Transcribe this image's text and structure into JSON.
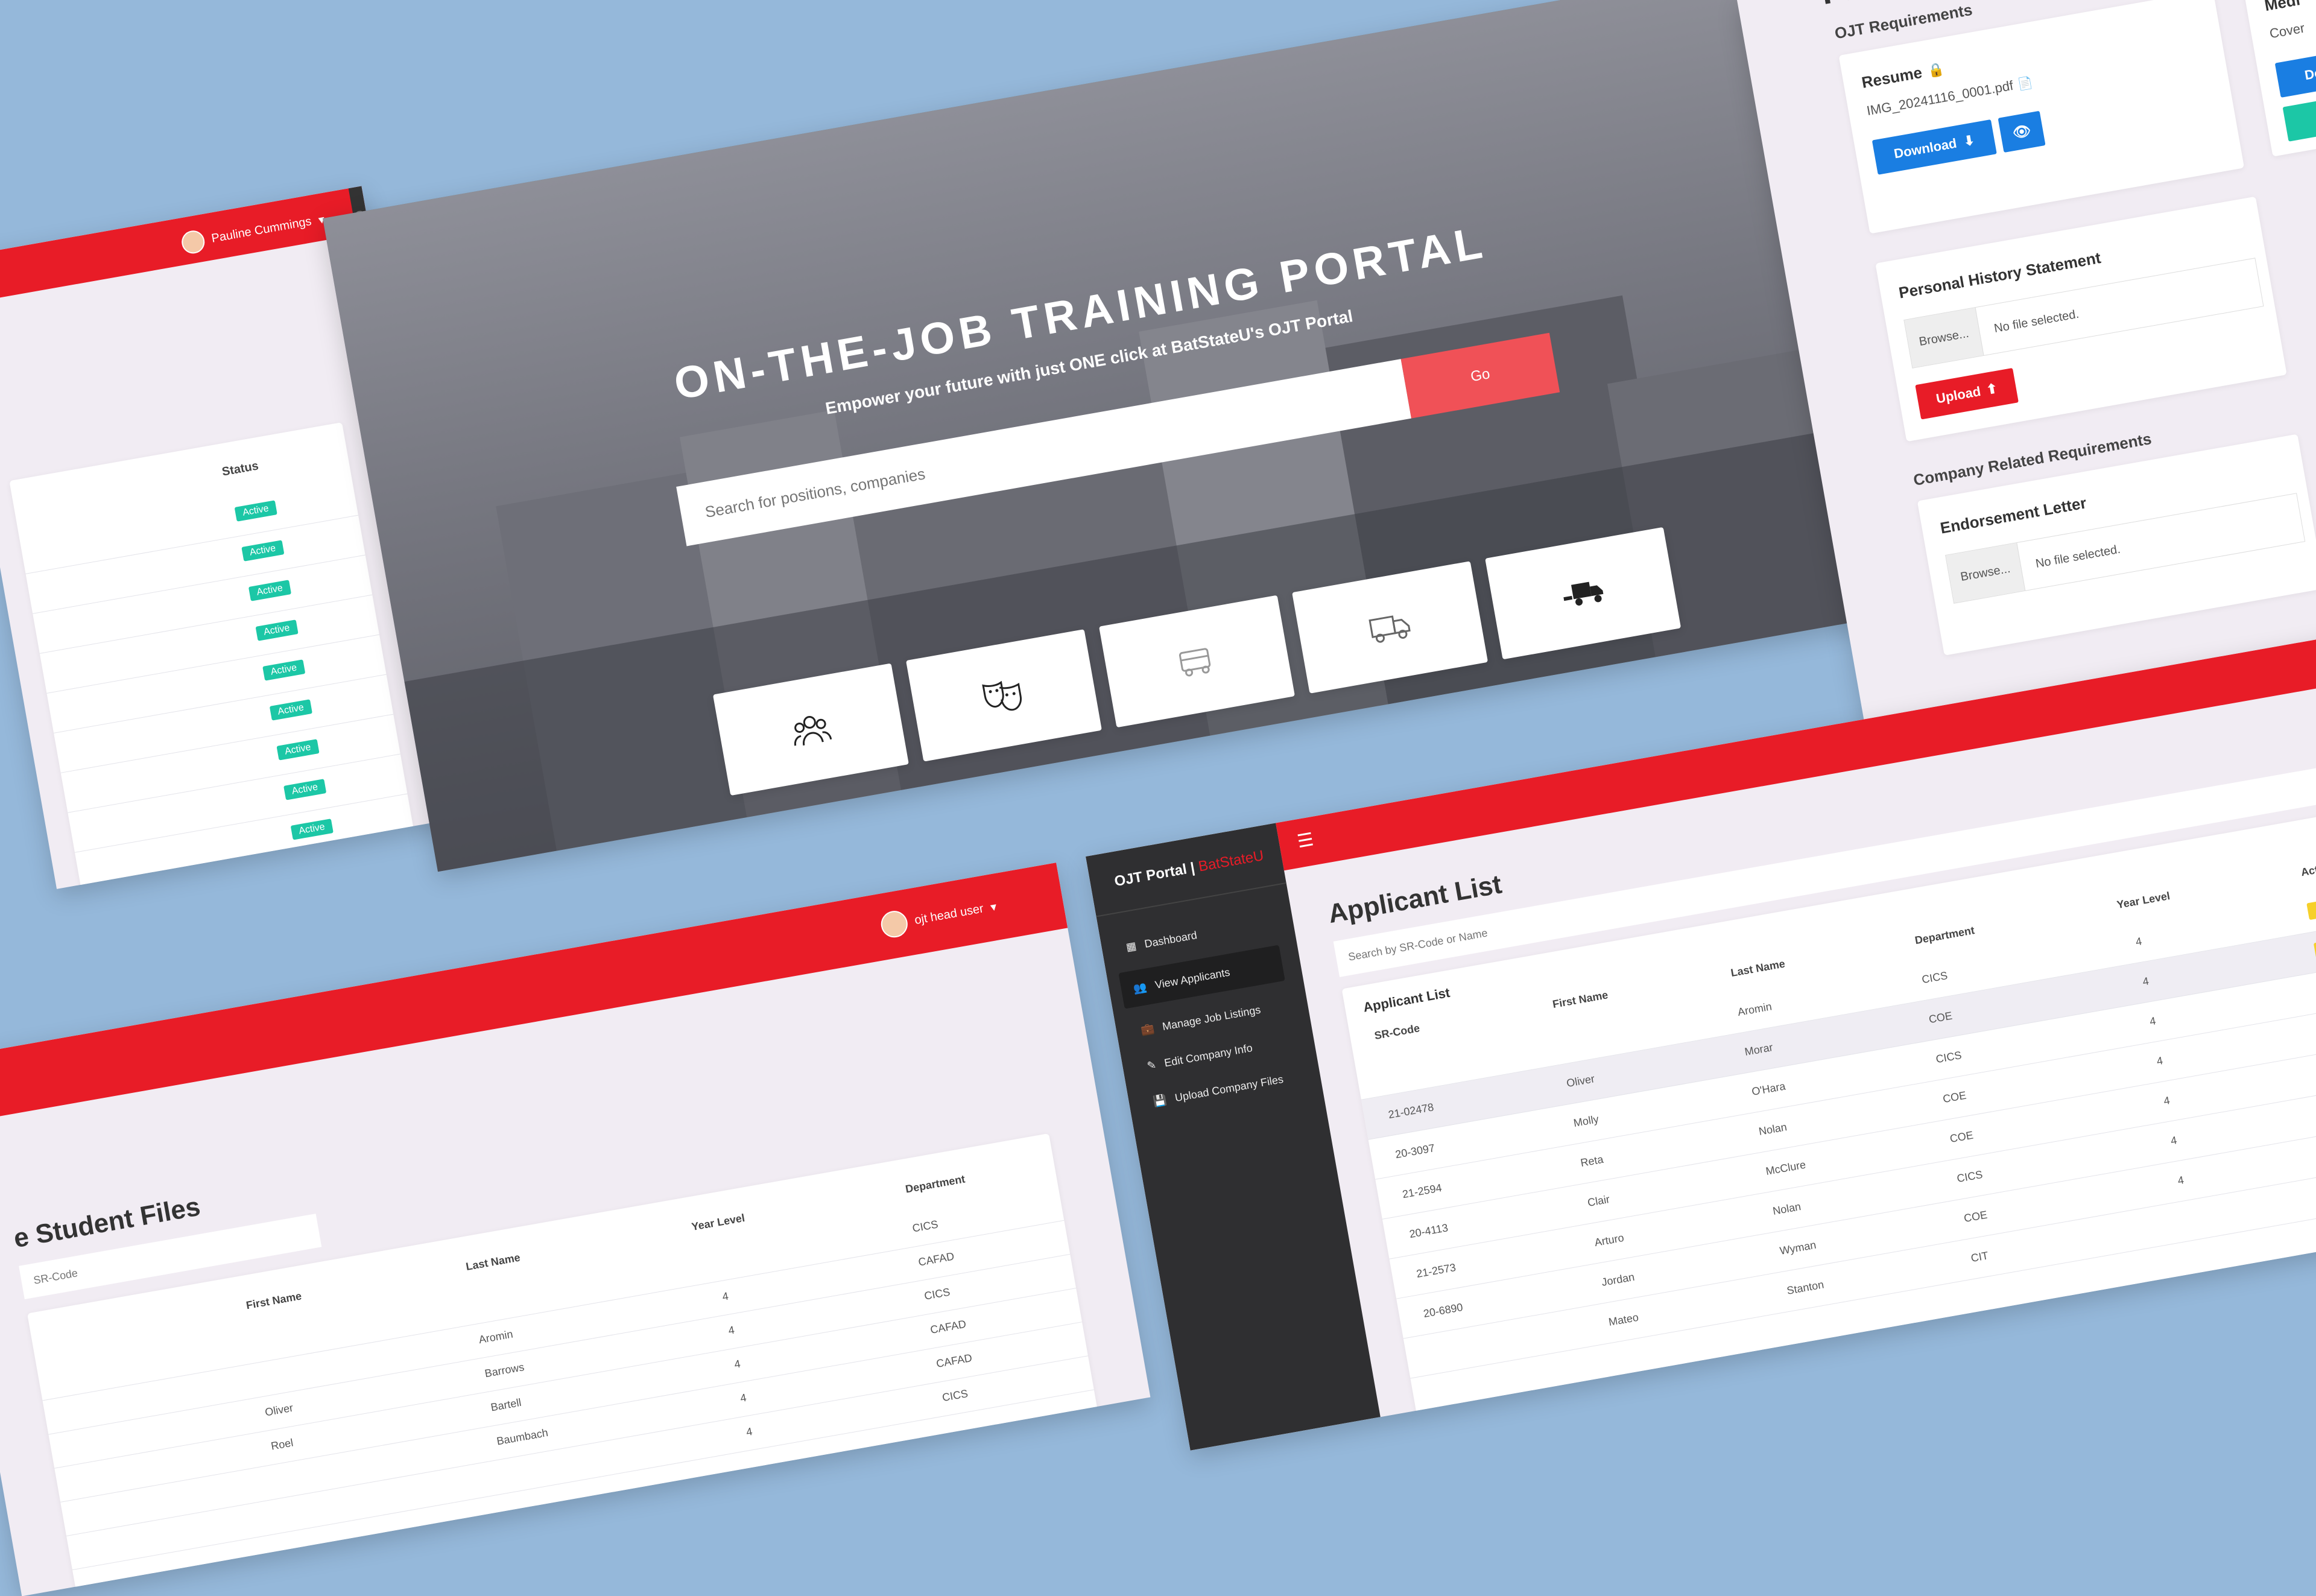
{
  "admin_panel": {
    "user_name": "Pauline Cummings",
    "status_header": "Status",
    "status_label": "Active",
    "status_count": 9
  },
  "hero": {
    "title": "ON-THE-JOB TRAINING PORTAL",
    "subtitle": "Empower your future with just ONE click at BatStateU's OJT Portal",
    "search_placeholder": "Search for positions, companies",
    "go_label": "Go",
    "categories": [
      "people-icon",
      "theater-masks-icon",
      "bus-icon",
      "truck-icon",
      "truck-loading-icon"
    ]
  },
  "requirements": {
    "title": "Pre-Ojt Requ",
    "section_ojt": "OJT Requirements",
    "resume_label": "Resume",
    "resume_file": "IMG_20241116_0001.pdf",
    "download_label": "Download",
    "personal_history": "Personal History Statement",
    "browse_label": "Browse...",
    "no_file": "No file selected.",
    "upload_label": "Upload",
    "company_section": "Company Related Requirements",
    "endorsement": "Endorsement Letter",
    "side_title": "Medi",
    "side_sub": "Cover",
    "side_btn": "Do"
  },
  "student_files": {
    "user_name": "ojt head user",
    "title": "e Student Files",
    "search_placeholder": "SR-Code",
    "headers": {
      "first": "First Name",
      "last": "Last Name",
      "year": "Year Level",
      "dept": "Department"
    },
    "rows": [
      {
        "first": "",
        "last": "",
        "year": "",
        "dept": "CICS"
      },
      {
        "first": "",
        "last": "Aromin",
        "year": "4",
        "dept": "CAFAD"
      },
      {
        "first": "Oliver",
        "last": "Barrows",
        "year": "4",
        "dept": "CICS"
      },
      {
        "first": "Roel",
        "last": "Bartell",
        "year": "4",
        "dept": "CAFAD"
      },
      {
        "first": "",
        "last": "Baumbach",
        "year": "4",
        "dept": "CAFAD"
      },
      {
        "first": "",
        "last": "",
        "year": "4",
        "dept": "CICS"
      }
    ]
  },
  "applicants": {
    "brand_left": "OJT Portal |",
    "brand_right": "BatStateU",
    "menu": [
      "Dashboard",
      "View Applicants",
      "Manage Job Listings",
      "Edit Company Info",
      "Upload Company Files"
    ],
    "page_title": "Applicant List",
    "search_placeholder": "Search by SR-Code or Name",
    "table_title": "Applicant List",
    "headers": {
      "sr": "SR-Code",
      "first": "First Name",
      "last": "Last Name",
      "dept": "Department",
      "year": "Year Level",
      "actions": "Actions"
    },
    "rows": [
      {
        "sr": "",
        "first": "",
        "last": "Aromin",
        "dept": "CICS",
        "year": "4"
      },
      {
        "sr": "21-02478",
        "first": "Oliver",
        "last": "Morar",
        "dept": "COE",
        "year": "4"
      },
      {
        "sr": "20-3097",
        "first": "Molly",
        "last": "O'Hara",
        "dept": "CICS",
        "year": "4"
      },
      {
        "sr": "21-2594",
        "first": "Reta",
        "last": "Nolan",
        "dept": "COE",
        "year": "4"
      },
      {
        "sr": "20-4113",
        "first": "Clair",
        "last": "McClure",
        "dept": "COE",
        "year": "4"
      },
      {
        "sr": "21-2573",
        "first": "Arturo",
        "last": "Nolan",
        "dept": "CICS",
        "year": "4"
      },
      {
        "sr": "20-6890",
        "first": "Jordan",
        "last": "Wyman",
        "dept": "COE",
        "year": "4"
      },
      {
        "sr": "",
        "first": "Mateo",
        "last": "Stanton",
        "dept": "CIT",
        "year": ""
      }
    ]
  }
}
